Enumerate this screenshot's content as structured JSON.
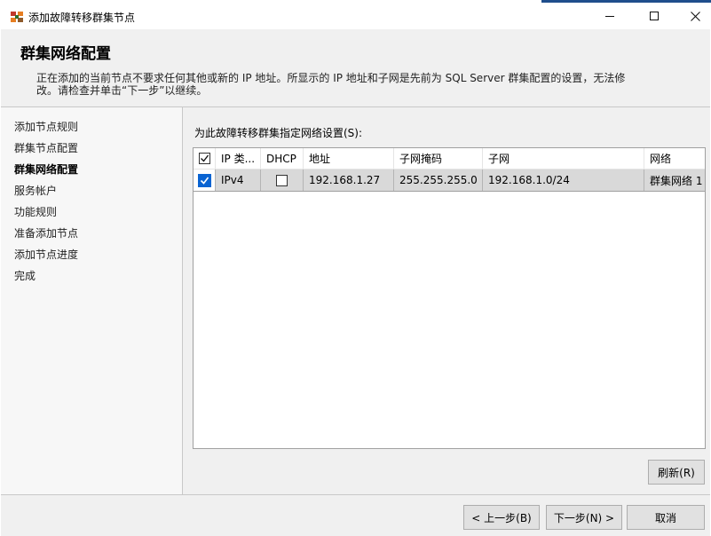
{
  "window": {
    "title": "添加故障转移群集节点",
    "icon": "cluster-app-icon",
    "accent_color": "#1f4e8c"
  },
  "header": {
    "title": "群集网络配置",
    "description": "正在添加的当前节点不要求任何其他或新的 IP 地址。所显示的 IP 地址和子网是先前为 SQL Server 群集配置的设置，无法修改。请检查并单击“下一步”以继续。"
  },
  "nav": {
    "items": [
      {
        "label": "添加节点规则",
        "active": false
      },
      {
        "label": "群集节点配置",
        "active": false
      },
      {
        "label": "群集网络配置",
        "active": true
      },
      {
        "label": "服务帐户",
        "active": false
      },
      {
        "label": "功能规则",
        "active": false
      },
      {
        "label": "准备添加节点",
        "active": false
      },
      {
        "label": "添加节点进度",
        "active": false
      },
      {
        "label": "完成",
        "active": false
      }
    ]
  },
  "content": {
    "label": "为此故障转移群集指定网络设置(S):",
    "grid": {
      "header_checked": true,
      "columns": [
        "IP 类...",
        "DHCP",
        "地址",
        "子网掩码",
        "子网",
        "网络"
      ],
      "rows": [
        {
          "checked": true,
          "ip_type": "IPv4",
          "dhcp": false,
          "address": "192.168.1.27",
          "subnet_mask": "255.255.255.0",
          "subnet": "192.168.1.0/24",
          "network": "群集网络 1"
        }
      ]
    },
    "refresh_label": "刷新(R)"
  },
  "footer": {
    "back_label": "< 上一步(B)",
    "next_label": "下一步(N) >",
    "cancel_label": "取消"
  }
}
